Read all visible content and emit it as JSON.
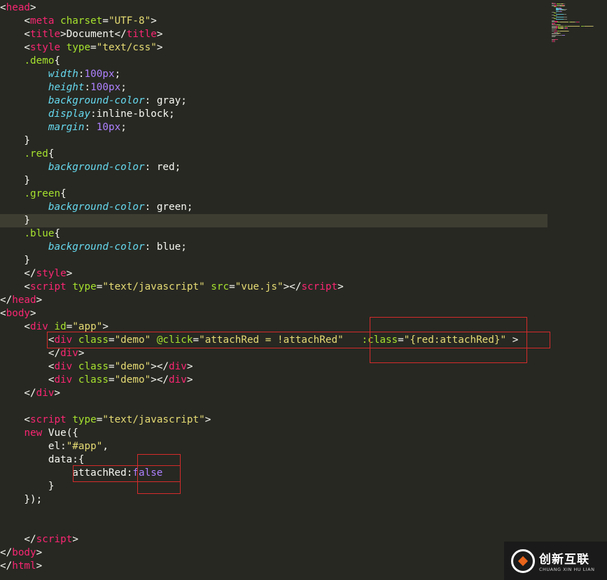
{
  "colors": {
    "background": "#272822",
    "tag": "#f92672",
    "attribute": "#a6e22e",
    "string": "#e6db74",
    "property": "#66d9ef",
    "number": "#ae81ff",
    "highlight_box": "#d42b2b",
    "active_line": "#3e3d32"
  },
  "code_lines": [
    [
      [
        "p",
        "<"
      ],
      [
        "tag",
        "head"
      ],
      [
        "p",
        ">"
      ]
    ],
    [
      [
        "p",
        "    <"
      ],
      [
        "tag",
        "meta"
      ],
      [
        "p",
        " "
      ],
      [
        "attr",
        "charset"
      ],
      [
        "p",
        "="
      ],
      [
        "str",
        "\"UTF-8\""
      ],
      [
        "p",
        ">"
      ]
    ],
    [
      [
        "p",
        "    <"
      ],
      [
        "tag",
        "title"
      ],
      [
        "p",
        ">Document</"
      ],
      [
        "tag",
        "title"
      ],
      [
        "p",
        ">"
      ]
    ],
    [
      [
        "p",
        "    <"
      ],
      [
        "tag",
        "style"
      ],
      [
        "p",
        " "
      ],
      [
        "attr",
        "type"
      ],
      [
        "p",
        "="
      ],
      [
        "str",
        "\"text/css\""
      ],
      [
        "p",
        ">"
      ]
    ],
    [
      [
        "p",
        "    "
      ],
      [
        "cls",
        ".demo"
      ],
      [
        "p",
        "{"
      ]
    ],
    [
      [
        "p",
        "        "
      ],
      [
        "prop",
        "width"
      ],
      [
        "p",
        ":"
      ],
      [
        "num",
        "100px"
      ],
      [
        "p",
        ";"
      ]
    ],
    [
      [
        "p",
        "        "
      ],
      [
        "prop",
        "height"
      ],
      [
        "p",
        ":"
      ],
      [
        "num",
        "100px"
      ],
      [
        "p",
        ";"
      ]
    ],
    [
      [
        "p",
        "        "
      ],
      [
        "prop",
        "background-color"
      ],
      [
        "p",
        ": gray;"
      ]
    ],
    [
      [
        "p",
        "        "
      ],
      [
        "prop",
        "display"
      ],
      [
        "p",
        ":inline-block;"
      ]
    ],
    [
      [
        "p",
        "        "
      ],
      [
        "prop",
        "margin"
      ],
      [
        "p",
        ": "
      ],
      [
        "num",
        "10px"
      ],
      [
        "p",
        ";"
      ]
    ],
    [
      [
        "p",
        "    }"
      ]
    ],
    [
      [
        "p",
        "    "
      ],
      [
        "cls",
        ".red"
      ],
      [
        "p",
        "{"
      ]
    ],
    [
      [
        "p",
        "        "
      ],
      [
        "prop",
        "background-color"
      ],
      [
        "p",
        ": red;"
      ]
    ],
    [
      [
        "p",
        "    }"
      ]
    ],
    [
      [
        "p",
        "    "
      ],
      [
        "cls",
        ".green"
      ],
      [
        "p",
        "{"
      ]
    ],
    [
      [
        "p",
        "        "
      ],
      [
        "prop",
        "background-color"
      ],
      [
        "p",
        ": green;"
      ]
    ],
    [
      [
        "p",
        "    }"
      ]
    ],
    [
      [
        "p",
        "    "
      ],
      [
        "cls",
        ".blue"
      ],
      [
        "p",
        "{"
      ]
    ],
    [
      [
        "p",
        "        "
      ],
      [
        "prop",
        "background-color"
      ],
      [
        "p",
        ": blue;"
      ]
    ],
    [
      [
        "p",
        "    }"
      ]
    ],
    [
      [
        "p",
        "    </"
      ],
      [
        "tag",
        "style"
      ],
      [
        "p",
        ">"
      ]
    ],
    [
      [
        "p",
        "    <"
      ],
      [
        "tag",
        "script"
      ],
      [
        "p",
        " "
      ],
      [
        "attr",
        "type"
      ],
      [
        "p",
        "="
      ],
      [
        "str",
        "\"text/javascript\""
      ],
      [
        "p",
        " "
      ],
      [
        "attr",
        "src"
      ],
      [
        "p",
        "="
      ],
      [
        "str",
        "\"vue.js\""
      ],
      [
        "p",
        "></"
      ],
      [
        "tag",
        "script"
      ],
      [
        "p",
        ">"
      ]
    ],
    [
      [
        "p",
        "</"
      ],
      [
        "tag",
        "head"
      ],
      [
        "p",
        ">"
      ]
    ],
    [
      [
        "p",
        "<"
      ],
      [
        "tag",
        "body"
      ],
      [
        "p",
        ">"
      ]
    ],
    [
      [
        "p",
        "    <"
      ],
      [
        "tag",
        "div"
      ],
      [
        "p",
        " "
      ],
      [
        "attr",
        "id"
      ],
      [
        "p",
        "="
      ],
      [
        "str",
        "\"app\""
      ],
      [
        "p",
        ">"
      ]
    ],
    [
      [
        "p",
        "        <"
      ],
      [
        "tag",
        "div"
      ],
      [
        "p",
        " "
      ],
      [
        "attr",
        "class"
      ],
      [
        "p",
        "="
      ],
      [
        "str",
        "\"demo\""
      ],
      [
        "p",
        " "
      ],
      [
        "attr",
        "@click"
      ],
      [
        "p",
        "="
      ],
      [
        "str",
        "\"attachRed = !attachRed\""
      ],
      [
        "p",
        "   "
      ],
      [
        "attr",
        ":class"
      ],
      [
        "p",
        "="
      ],
      [
        "str",
        "\"{red:attachRed}\""
      ],
      [
        "p",
        " >"
      ]
    ],
    [
      [
        "p",
        "        </"
      ],
      [
        "tag",
        "div"
      ],
      [
        "p",
        ">"
      ]
    ],
    [
      [
        "p",
        "        <"
      ],
      [
        "tag",
        "div"
      ],
      [
        "p",
        " "
      ],
      [
        "attr",
        "class"
      ],
      [
        "p",
        "="
      ],
      [
        "str",
        "\"demo\""
      ],
      [
        "p",
        "></"
      ],
      [
        "tag",
        "div"
      ],
      [
        "p",
        ">"
      ]
    ],
    [
      [
        "p",
        "        <"
      ],
      [
        "tag",
        "div"
      ],
      [
        "p",
        " "
      ],
      [
        "attr",
        "class"
      ],
      [
        "p",
        "="
      ],
      [
        "str",
        "\"demo\""
      ],
      [
        "p",
        "></"
      ],
      [
        "tag",
        "div"
      ],
      [
        "p",
        ">"
      ]
    ],
    [
      [
        "p",
        "    </"
      ],
      [
        "tag",
        "div"
      ],
      [
        "p",
        ">"
      ]
    ],
    [],
    [
      [
        "p",
        "    <"
      ],
      [
        "tag",
        "script"
      ],
      [
        "p",
        " "
      ],
      [
        "attr",
        "type"
      ],
      [
        "p",
        "="
      ],
      [
        "str",
        "\"text/javascript\""
      ],
      [
        "p",
        ">"
      ]
    ],
    [
      [
        "p",
        "    "
      ],
      [
        "kw",
        "new"
      ],
      [
        "p",
        " Vue({"
      ]
    ],
    [
      [
        "p",
        "        el:"
      ],
      [
        "str",
        "\"#app\""
      ],
      [
        "p",
        ","
      ]
    ],
    [
      [
        "p",
        "        data:{"
      ]
    ],
    [
      [
        "p",
        "            attachRed:"
      ],
      [
        "bool",
        "false"
      ]
    ],
    [
      [
        "p",
        "        }"
      ]
    ],
    [
      [
        "p",
        "    });"
      ]
    ],
    [],
    [],
    [
      [
        "p",
        "    </"
      ],
      [
        "tag",
        "script"
      ],
      [
        "p",
        ">"
      ]
    ],
    [
      [
        "p",
        "</"
      ],
      [
        "tag",
        "body"
      ],
      [
        "p",
        ">"
      ]
    ],
    [
      [
        "p",
        "</"
      ],
      [
        "tag",
        "html"
      ],
      [
        "p",
        ">"
      ]
    ]
  ],
  "active_line_index": 16,
  "logo": {
    "name": "创新互联",
    "subtitle": "CHUANG XIN HU LIAN"
  }
}
